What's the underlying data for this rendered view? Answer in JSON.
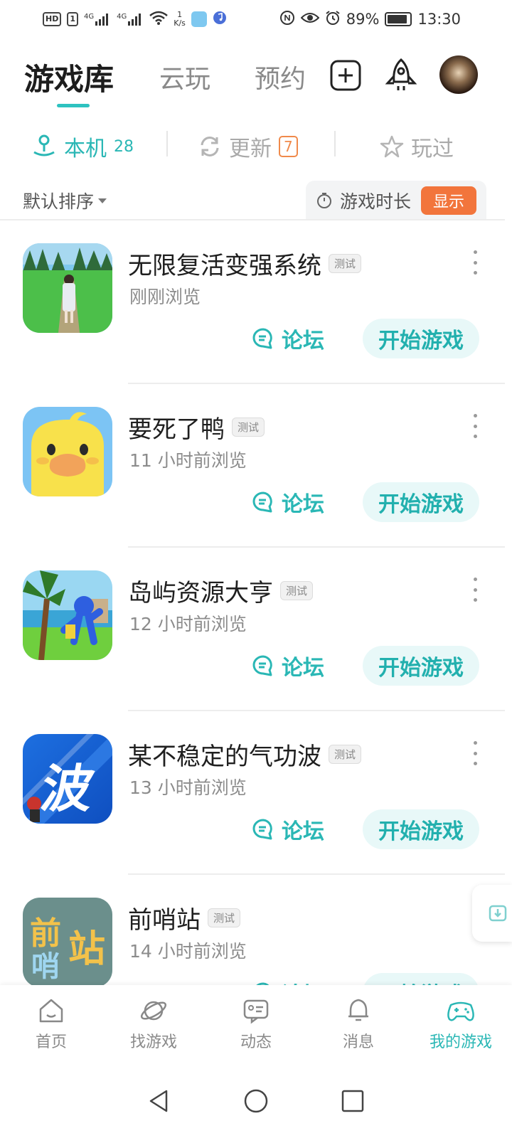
{
  "status_bar": {
    "network_chip": "HD",
    "sim": "1",
    "signal1": "4G",
    "signal2": "4G",
    "speed_value": "1",
    "speed_unit": "K/s",
    "battery": "89%",
    "battery_level": 0.89,
    "time": "13:30"
  },
  "top_tabs": [
    "游戏库",
    "云玩",
    "预约"
  ],
  "sub_tabs": {
    "local": {
      "label": "本机",
      "count": "28"
    },
    "update": {
      "label": "更新",
      "count": "7"
    },
    "played": {
      "label": "玩过"
    }
  },
  "sort": {
    "label": "默认排序"
  },
  "duration": {
    "label": "游戏时长",
    "button": "显示"
  },
  "games": [
    {
      "title": "无限复活变强系统",
      "tag": "测试",
      "subtitle": "刚刚浏览",
      "forum": "论坛",
      "start": "开始游戏",
      "icon": "girl-forest-game-icon"
    },
    {
      "title": "要死了鸭",
      "tag": "测试",
      "subtitle": "11 小时前浏览",
      "forum": "论坛",
      "start": "开始游戏",
      "icon": "yellow-duck-game-icon"
    },
    {
      "title": "岛屿资源大亨",
      "tag": "测试",
      "subtitle": "12 小时前浏览",
      "forum": "论坛",
      "start": "开始游戏",
      "icon": "island-runner-game-icon"
    },
    {
      "title": "某不稳定的气功波",
      "tag": "测试",
      "subtitle": "13 小时前浏览",
      "forum": "论坛",
      "start": "开始游戏",
      "icon": "wave-character-game-icon"
    },
    {
      "title": "前哨站",
      "tag": "测试",
      "subtitle": "14 小时前浏览",
      "forum": "论坛",
      "start": "开始游戏",
      "icon": "outpost-game-icon"
    }
  ],
  "bottom_nav": [
    "首页",
    "找游戏",
    "动态",
    "消息",
    "我的游戏"
  ],
  "icon_text": {
    "game4": "波",
    "game5_line1": "前",
    "game5_line1b": "站",
    "game5_line2": "哨"
  },
  "colors": {
    "accent": "#2ab7b5",
    "orange": "#f2753c"
  }
}
